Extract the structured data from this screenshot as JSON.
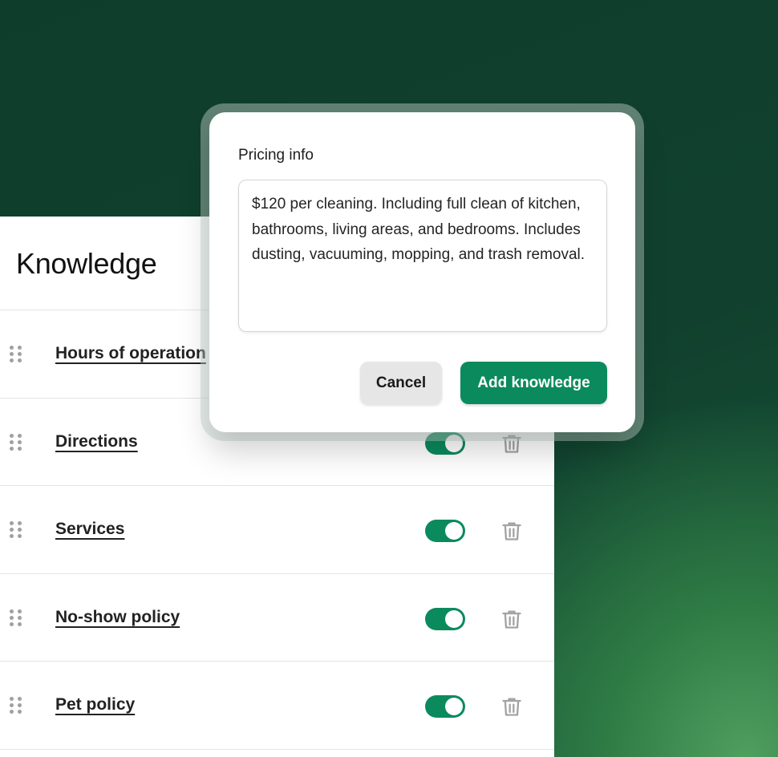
{
  "knowledge": {
    "title": "Knowledge",
    "items": [
      {
        "label": "Hours of operation",
        "enabled": true
      },
      {
        "label": "Directions",
        "enabled": true
      },
      {
        "label": "Services",
        "enabled": true
      },
      {
        "label": "No-show policy",
        "enabled": true
      },
      {
        "label": "Pet policy",
        "enabled": true
      }
    ],
    "icons": {
      "drag": "drag-handle-icon",
      "delete": "trash-icon"
    }
  },
  "modal": {
    "label": "Pricing info",
    "textarea_value": "$120 per cleaning. Including full clean of kitchen, bathrooms, living areas, and bedrooms. Includes dusting, vacuuming, mopping, and trash removal.",
    "cancel_label": "Cancel",
    "submit_label": "Add knowledge"
  },
  "colors": {
    "accent": "#0b8a5e",
    "background_dark": "#0f3d2c",
    "background_light": "#4f9f5f"
  }
}
